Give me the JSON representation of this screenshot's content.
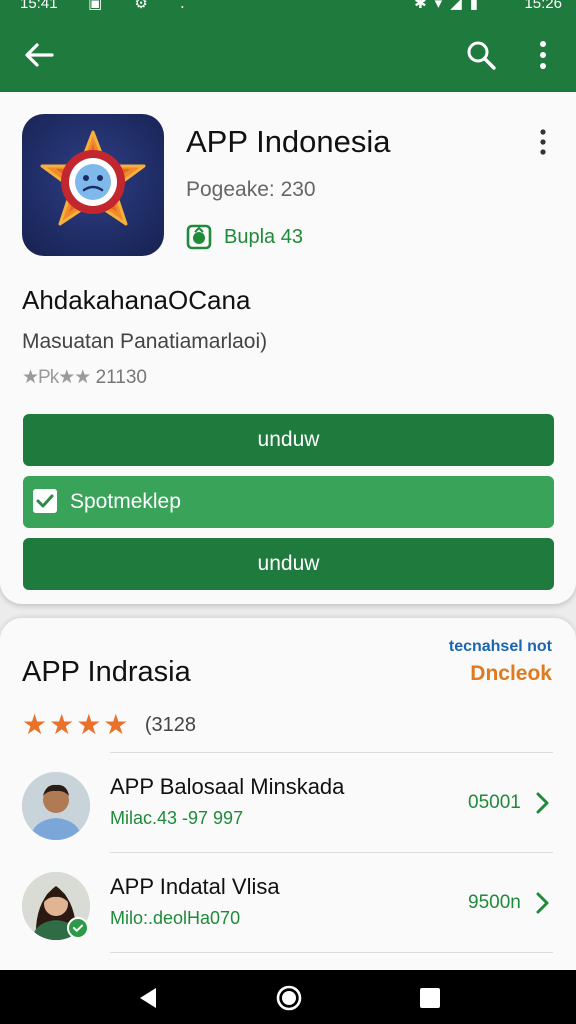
{
  "status_bar": {
    "time_left": "15:41",
    "time_right": "15:26"
  },
  "app_bar": {
    "back_icon": "arrow-left-icon",
    "search_icon": "search-icon",
    "more_icon": "more-vert-icon",
    "color": "#1f7a3e"
  },
  "app_header": {
    "icon": "star-face-icon",
    "title": "APP Indonesia",
    "package": "Pogeake: 230",
    "badge_label": "Bupla 43"
  },
  "developer": {
    "name": "AhdakahanaOCana",
    "category": "Masuatan Panatiamarlaoi)",
    "rating_stars": "★Pk★★",
    "rating_count": "21130"
  },
  "buttons": {
    "primary_label": "unduw",
    "checkbox_label": "Spotmeklep",
    "secondary_label": "unduw"
  },
  "section": {
    "title": "APP Indrasia",
    "corner_small": "tecnahsel not",
    "corner_link": "Dncleok",
    "stars": "★★★★",
    "rating_count": "(3128"
  },
  "list": [
    {
      "title": "APP Balosaal Minskada",
      "subtitle": "Milac.43 -97 997",
      "value": "05001"
    },
    {
      "title": "APP Indatal Vlisa",
      "subtitle": "Milo:.deolHa070",
      "value": "9500n"
    }
  ],
  "colors": {
    "primary_green": "#1f7a3e",
    "light_green": "#3aa35a",
    "accent_orange": "#e07a1f",
    "link_blue": "#1b66b0"
  }
}
